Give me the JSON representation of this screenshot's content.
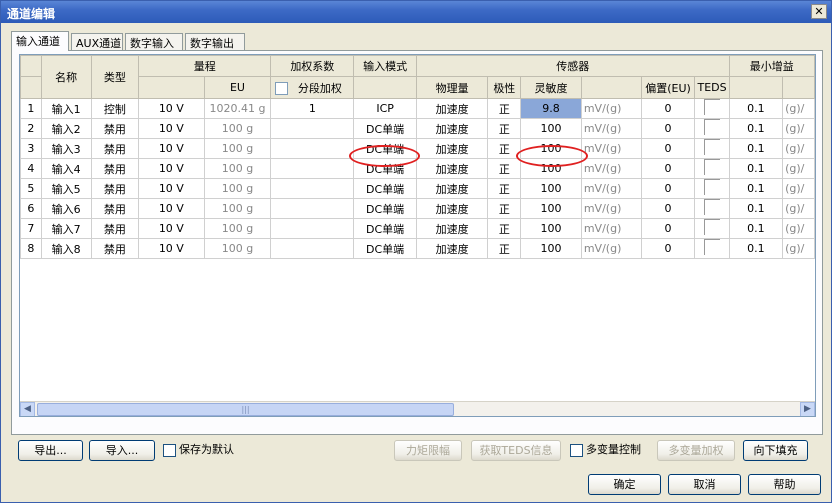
{
  "window": {
    "title": "通道编辑",
    "close_glyph": "✕"
  },
  "tabs": [
    {
      "label": "输入通道",
      "active": true
    },
    {
      "label": "AUX通道",
      "active": false
    },
    {
      "label": "数字输入",
      "active": false
    },
    {
      "label": "数字输出",
      "active": false
    }
  ],
  "headers": {
    "name": "名称",
    "type": "类型",
    "range": "量程",
    "weight": "加权系数",
    "mode": "输入模式",
    "sensor": "传感器",
    "min_gain": "最小增益",
    "eu": "EU",
    "segment_weight": "分段加权",
    "physical": "物理量",
    "polarity": "极性",
    "sensitivity": "灵敏度",
    "offset": "偏置(EU)",
    "teds": "TEDS"
  },
  "rows": [
    {
      "no": "1",
      "name": "输入1",
      "type": "控制",
      "range": "10 V",
      "eu": "1020.41 g",
      "weight": "1",
      "mode": "ICP",
      "physical": "加速度",
      "polarity": "正",
      "sensitivity": "9.8",
      "unit": "mV/(g)",
      "offset": "0",
      "gain": "0.1",
      "gain_unit": "(g)/"
    },
    {
      "no": "2",
      "name": "输入2",
      "type": "禁用",
      "range": "10 V",
      "eu": "100 g",
      "weight": "",
      "mode": "DC单端",
      "physical": "加速度",
      "polarity": "正",
      "sensitivity": "100",
      "unit": "mV/(g)",
      "offset": "0",
      "gain": "0.1",
      "gain_unit": "(g)/"
    },
    {
      "no": "3",
      "name": "输入3",
      "type": "禁用",
      "range": "10 V",
      "eu": "100 g",
      "weight": "",
      "mode": "DC单端",
      "physical": "加速度",
      "polarity": "正",
      "sensitivity": "100",
      "unit": "mV/(g)",
      "offset": "0",
      "gain": "0.1",
      "gain_unit": "(g)/"
    },
    {
      "no": "4",
      "name": "输入4",
      "type": "禁用",
      "range": "10 V",
      "eu": "100 g",
      "weight": "",
      "mode": "DC单端",
      "physical": "加速度",
      "polarity": "正",
      "sensitivity": "100",
      "unit": "mV/(g)",
      "offset": "0",
      "gain": "0.1",
      "gain_unit": "(g)/"
    },
    {
      "no": "5",
      "name": "输入5",
      "type": "禁用",
      "range": "10 V",
      "eu": "100 g",
      "weight": "",
      "mode": "DC单端",
      "physical": "加速度",
      "polarity": "正",
      "sensitivity": "100",
      "unit": "mV/(g)",
      "offset": "0",
      "gain": "0.1",
      "gain_unit": "(g)/"
    },
    {
      "no": "6",
      "name": "输入6",
      "type": "禁用",
      "range": "10 V",
      "eu": "100 g",
      "weight": "",
      "mode": "DC单端",
      "physical": "加速度",
      "polarity": "正",
      "sensitivity": "100",
      "unit": "mV/(g)",
      "offset": "0",
      "gain": "0.1",
      "gain_unit": "(g)/"
    },
    {
      "no": "7",
      "name": "输入7",
      "type": "禁用",
      "range": "10 V",
      "eu": "100 g",
      "weight": "",
      "mode": "DC单端",
      "physical": "加速度",
      "polarity": "正",
      "sensitivity": "100",
      "unit": "mV/(g)",
      "offset": "0",
      "gain": "0.1",
      "gain_unit": "(g)/"
    },
    {
      "no": "8",
      "name": "输入8",
      "type": "禁用",
      "range": "10 V",
      "eu": "100 g",
      "weight": "",
      "mode": "DC单端",
      "physical": "加速度",
      "polarity": "正",
      "sensitivity": "100",
      "unit": "mV/(g)",
      "offset": "0",
      "gain": "0.1",
      "gain_unit": "(g)/"
    }
  ],
  "scroll": {
    "left": "◀",
    "right": "▶",
    "grip": "|||"
  },
  "toolbar": {
    "export": "导出...",
    "import": "导入...",
    "save_default": "保存为默认",
    "torque_limit": "力矩限幅",
    "get_teds": "获取TEDS信息",
    "multi_var_control": "多变量控制",
    "multi_var_weight": "多变量加权",
    "fill_down": "向下填充"
  },
  "footer": {
    "ok": "确定",
    "cancel": "取消",
    "help": "帮助"
  },
  "colors": {
    "title_bar": "#3d6ac6",
    "selected_cell": "#8aa7d8",
    "highlight_ring": "#e02020"
  }
}
